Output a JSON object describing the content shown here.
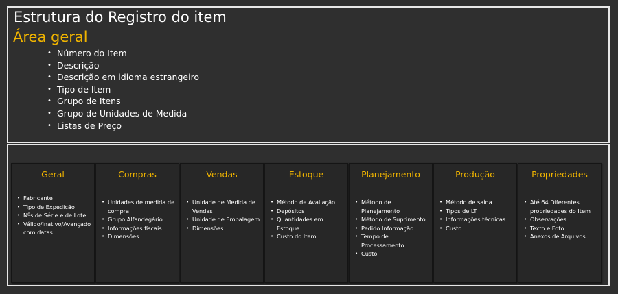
{
  "header": {
    "title": "Estrutura do Registro do item",
    "section": "Área geral"
  },
  "general_fields": [
    "Número do Item",
    "Descrição",
    "Descrição em idioma estrangeiro",
    "Tipo de Item",
    "Grupo de Itens",
    "Grupo de Unidades de Medida",
    "Listas de Preço"
  ],
  "tabs": [
    {
      "title": "Geral",
      "items": [
        "Fabricante",
        "Tipo de Expedição",
        "Nºs de Série e de Lote",
        "Válido/Inativo/Avançado com datas"
      ]
    },
    {
      "title": "Compras",
      "items": [
        "Unidades de medida de compra",
        "Grupo Alfandegário",
        "Informações fiscais",
        "Dimensões"
      ]
    },
    {
      "title": "Vendas",
      "items": [
        "Unidade de Medida de Vendas",
        "Unidade de Embalagem",
        "Dimensões"
      ]
    },
    {
      "title": "Estoque",
      "items": [
        "Método de Avaliação",
        "Depósitos",
        "Quantidades em Estoque",
        "Custo do Item"
      ]
    },
    {
      "title": "Planejamento",
      "items": [
        "Método de Planejamento",
        "Método de Suprimento",
        "Pedido Informação",
        "Tempo de Processamento",
        "Custo"
      ]
    },
    {
      "title": "Produção",
      "items": [
        "Método de saída",
        "Tipos de LT",
        "Informações técnicas",
        "Custo"
      ]
    },
    {
      "title": "Propriedades",
      "items": [
        "Até 64 Diferentes propriedades do Item",
        "Observações",
        "Texto e Foto",
        "Anexos de Arquivos"
      ]
    }
  ],
  "colors": {
    "accent": "#f0b400",
    "background": "#2f2f2f",
    "card": "#272727",
    "border": "#e8e8e8"
  }
}
